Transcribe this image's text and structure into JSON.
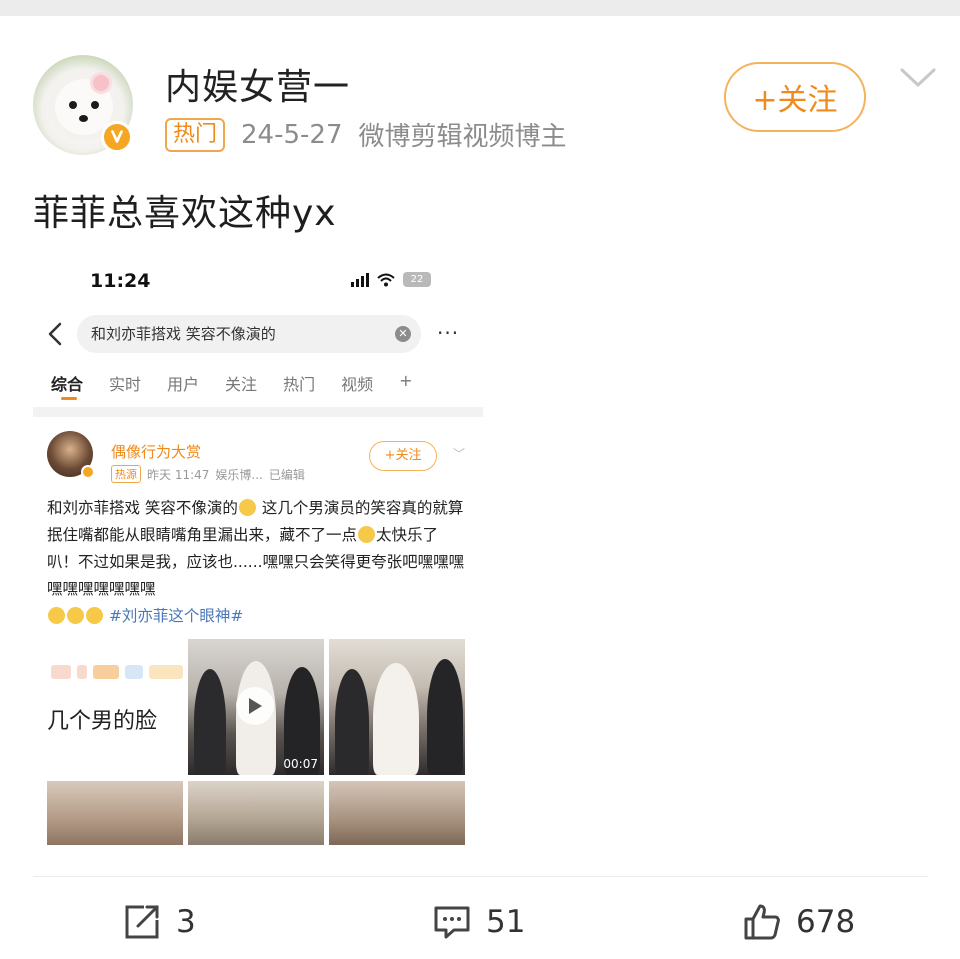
{
  "post": {
    "author": "内娱女营一",
    "badge": "热门",
    "date": "24-5-27",
    "author_desc": "微博剪辑视频博主",
    "follow_label": "+关注",
    "text": "菲菲总喜欢这种yx"
  },
  "embedded": {
    "status_time": "11:24",
    "battery": "22",
    "search_query": "和刘亦菲搭戏 笑容不像演的",
    "more_label": "···",
    "tabs": [
      "综合",
      "实时",
      "用户",
      "关注",
      "热门",
      "视频",
      "+"
    ],
    "active_tab": "综合",
    "card": {
      "author": "偶像行为大赏",
      "hot_badge": "热源",
      "time": "昨天 11:47",
      "source": "娱乐博...",
      "edited": "已编辑",
      "follow_label": "+关注",
      "body_1": "和刘亦菲搭戏 笑容不像演的",
      "body_2": " 这几个男演员的笑容真的就算抿住嘴都能从眼睛嘴角里漏出来，藏不了一点",
      "body_3": "太快乐了叭！不过如果是我，应该也......嘿嘿只会笑得更夸张吧嘿嘿嘿嘿嘿嘿嘿嘿嘿嘿",
      "hashtag": "#刘亦菲这个眼神#",
      "caption": "几个男的脸",
      "video_duration": "00:07"
    }
  },
  "actions": {
    "share_count": "3",
    "comment_count": "51",
    "like_count": "678"
  },
  "colors": {
    "accent": "#f08a1a",
    "link": "#4a78b8"
  }
}
